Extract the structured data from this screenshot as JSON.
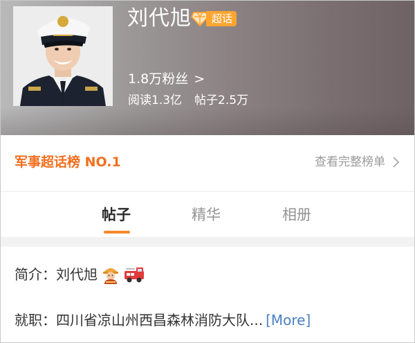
{
  "profile": {
    "name": "刘代旭",
    "badge_label": "超话",
    "fans": "1.8万粉丝",
    "fans_chevron": ">",
    "reads": "阅读1.3亿",
    "posts": "帖子2.5万"
  },
  "rank": {
    "title": "军事超话榜 NO.1",
    "link_label": "查看完整榜单"
  },
  "tabs": [
    {
      "label": "帖子",
      "active": true
    },
    {
      "label": "精华",
      "active": false
    },
    {
      "label": "相册",
      "active": false
    }
  ],
  "intro": {
    "label": "简介：",
    "value": "刘代旭",
    "icons": [
      "firefighter-icon",
      "fire-engine-icon"
    ]
  },
  "job": {
    "label": "就职：",
    "value": "四川省凉山州西昌森林消防大队...",
    "more": "[More]"
  },
  "colors": {
    "accent": "#f26f1e",
    "badge": "#ffa531",
    "tab_underline": "#f5892a",
    "link": "#4a7fc1"
  }
}
